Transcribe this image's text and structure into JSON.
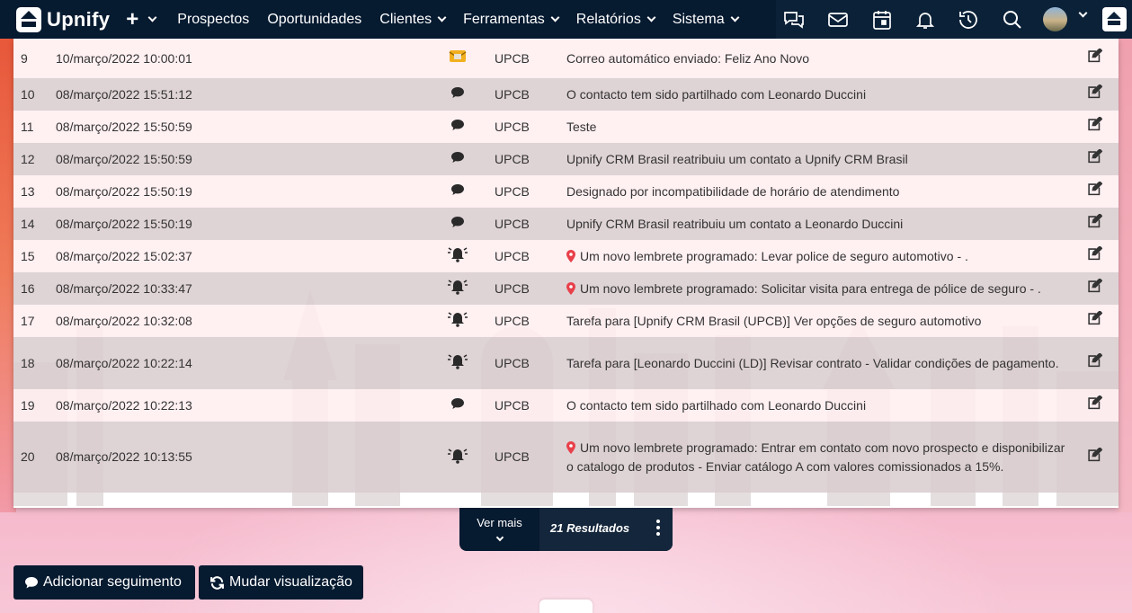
{
  "nav": {
    "brand": "Upnify",
    "plus": "+",
    "items": [
      {
        "label": "Prospectos",
        "dropdown": false
      },
      {
        "label": "Oportunidades",
        "dropdown": false
      },
      {
        "label": "Clientes",
        "dropdown": true
      },
      {
        "label": "Ferramentas",
        "dropdown": true
      },
      {
        "label": "Relatórios",
        "dropdown": true
      },
      {
        "label": "Sistema",
        "dropdown": true
      }
    ],
    "icons": [
      "chat-icon",
      "mail-icon",
      "calendar-icon",
      "bell-icon",
      "history-icon",
      "search-icon",
      "avatar",
      "app-icon"
    ]
  },
  "rows": [
    {
      "num": "9",
      "date": "10/março/2022 10:00:01",
      "type": "mail-icon",
      "user": "UPCB",
      "pin": false,
      "desc": "Correo automático enviado: Feliz Ano Novo"
    },
    {
      "num": "10",
      "date": "08/março/2022 15:51:12",
      "type": "comment-icon",
      "user": "UPCB",
      "pin": false,
      "desc": "O contacto tem sido partilhado com Leonardo Duccini"
    },
    {
      "num": "11",
      "date": "08/março/2022 15:50:59",
      "type": "comment-icon",
      "user": "UPCB",
      "pin": false,
      "desc": "Teste"
    },
    {
      "num": "12",
      "date": "08/março/2022 15:50:59",
      "type": "comment-icon",
      "user": "UPCB",
      "pin": false,
      "desc": "Upnify CRM Brasil reatribuiu um contato a Upnify CRM Brasil"
    },
    {
      "num": "13",
      "date": "08/março/2022 15:50:19",
      "type": "comment-icon",
      "user": "UPCB",
      "pin": false,
      "desc": "Designado por incompatibilidade de horário de atendimento"
    },
    {
      "num": "14",
      "date": "08/março/2022 15:50:19",
      "type": "comment-icon",
      "user": "UPCB",
      "pin": false,
      "desc": "Upnify CRM Brasil reatribuiu um contato a Leonardo Duccini"
    },
    {
      "num": "15",
      "date": "08/março/2022 15:02:37",
      "type": "bell-icon",
      "user": "UPCB",
      "pin": true,
      "desc": "Um novo lembrete programado: Levar police de seguro automotivo - ."
    },
    {
      "num": "16",
      "date": "08/março/2022 10:33:47",
      "type": "bell-icon",
      "user": "UPCB",
      "pin": true,
      "desc": "Um novo lembrete programado: Solicitar visita para entrega de pólice de seguro - ."
    },
    {
      "num": "17",
      "date": "08/março/2022 10:32:08",
      "type": "bell-icon",
      "user": "UPCB",
      "pin": false,
      "desc": "Tarefa para [Upnify CRM Brasil (UPCB)] Ver opções de seguro automotivo"
    },
    {
      "num": "18",
      "date": "08/março/2022 10:22:14",
      "type": "bell-icon",
      "user": "UPCB",
      "pin": false,
      "desc": "Tarefa para [Leonardo Duccini (LD)] Revisar contrato - Validar condições de pagamento."
    },
    {
      "num": "19",
      "date": "08/março/2022 10:22:13",
      "type": "comment-icon",
      "user": "UPCB",
      "pin": false,
      "desc": "O contacto tem sido partilhado com Leonardo Duccini"
    },
    {
      "num": "20",
      "date": "08/março/2022 10:13:55",
      "type": "bell-icon",
      "user": "UPCB",
      "pin": true,
      "desc": "Um novo lembrete programado: Entrar em contato com novo prospecto e disponibilizar o catalogo de produtos - Enviar catálogo A com valores comissionados a 15%."
    }
  ],
  "pager": {
    "more_label": "Ver mais",
    "results": "21 Resultados"
  },
  "actions": {
    "follow_label": "Adicionar seguimento",
    "view_label": "Mudar visualização"
  },
  "colors": {
    "nav_bg": "#061a30",
    "row_odd": "#ffeef0",
    "row_even": "#dacdcf",
    "pin": "#e8404a"
  }
}
